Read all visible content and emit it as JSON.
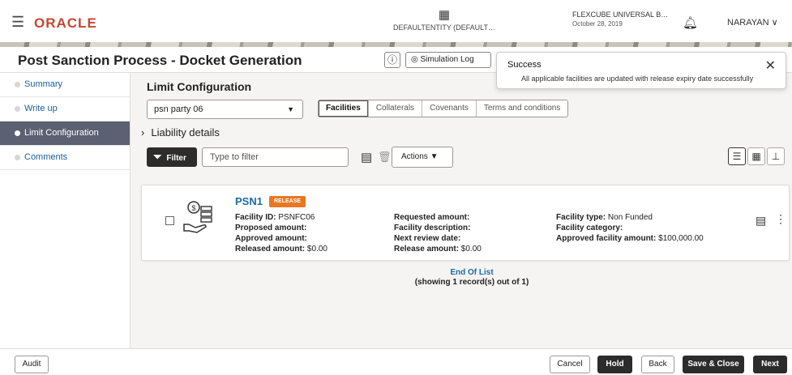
{
  "header": {
    "brand": "ORACLE",
    "entity": "DEFAULTENTITY (DEFAULT…",
    "app_name": "FLEXCUBE UNIVERSAL B…",
    "app_date": "October 28, 2019",
    "user": "NARAYAN"
  },
  "page": {
    "title": "Post Sanction Process - Docket Generation",
    "simulation_log": "Simulation Log"
  },
  "toast": {
    "title": "Success",
    "message": "All applicable facilities are updated with release expiry date successfully"
  },
  "sidebar": {
    "items": [
      {
        "label": "Summary"
      },
      {
        "label": "Write up"
      },
      {
        "label": "Limit Configuration"
      },
      {
        "label": "Comments"
      }
    ]
  },
  "main": {
    "section_title": "Limit Configuration",
    "party_select": "psn party 06",
    "tabs": [
      "Facilities",
      "Collaterals",
      "Covenants",
      "Terms and conditions"
    ],
    "liability_label": "Liability details",
    "filter_label": "Filter",
    "filter_placeholder": "Type to filter",
    "actions_label": "Actions"
  },
  "card": {
    "name": "PSN1",
    "badge": "RELEASE",
    "col1": [
      {
        "k": "Facility ID:",
        "v": " PSNFC06"
      },
      {
        "k": "Proposed amount:",
        "v": ""
      },
      {
        "k": "Approved amount:",
        "v": ""
      },
      {
        "k": "Released amount:",
        "v": " $0.00"
      }
    ],
    "col2": [
      {
        "k": "Requested amount:",
        "v": ""
      },
      {
        "k": "Facility description:",
        "v": ""
      },
      {
        "k": "Next review date:",
        "v": ""
      },
      {
        "k": "Release amount:",
        "v": " $0.00"
      }
    ],
    "col3": [
      {
        "k": "Facility type:",
        "v": " Non Funded"
      },
      {
        "k": "Facility category:",
        "v": ""
      },
      {
        "k": "Approved facility amount:",
        "v": " $100,000.00"
      }
    ]
  },
  "list_footer": {
    "end": "End Of List",
    "count": "(showing 1 record(s) out of 1)"
  },
  "footer": {
    "audit": "Audit",
    "cancel": "Cancel",
    "hold": "Hold",
    "back": "Back",
    "save_close": "Save & Close",
    "next": "Next"
  }
}
